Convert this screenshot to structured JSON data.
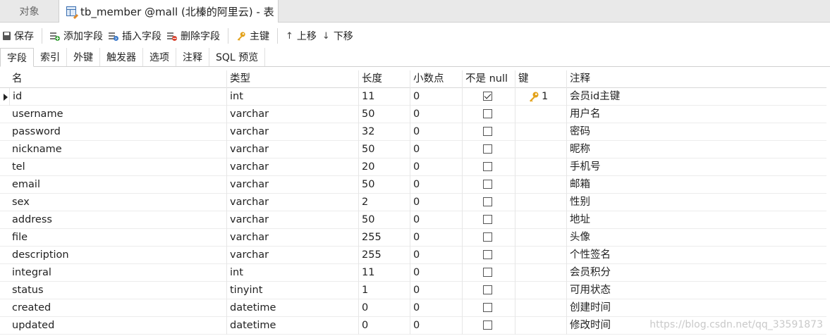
{
  "window_tabs": {
    "objects": "对象",
    "active": "tb_member @mall (北榛的阿里云) - 表"
  },
  "toolbar": {
    "save": "保存",
    "add_field": "添加字段",
    "insert_field": "插入字段",
    "delete_field": "删除字段",
    "primary_key": "主键",
    "move_up": "上移",
    "move_down": "下移"
  },
  "subtabs": [
    "字段",
    "索引",
    "外键",
    "触发器",
    "选项",
    "注释",
    "SQL 预览"
  ],
  "columns": {
    "name": "名",
    "type": "类型",
    "length": "长度",
    "decimals": "小数点",
    "not_null": "不是 null",
    "key": "键",
    "comment": "注释"
  },
  "rows": [
    {
      "name": "id",
      "type": "int",
      "length": "11",
      "decimals": "0",
      "not_null": true,
      "key": "1",
      "comment": "会员id主键"
    },
    {
      "name": "username",
      "type": "varchar",
      "length": "50",
      "decimals": "0",
      "not_null": false,
      "key": "",
      "comment": "用户名"
    },
    {
      "name": "password",
      "type": "varchar",
      "length": "32",
      "decimals": "0",
      "not_null": false,
      "key": "",
      "comment": "密码"
    },
    {
      "name": "nickname",
      "type": "varchar",
      "length": "50",
      "decimals": "0",
      "not_null": false,
      "key": "",
      "comment": "昵称"
    },
    {
      "name": "tel",
      "type": "varchar",
      "length": "20",
      "decimals": "0",
      "not_null": false,
      "key": "",
      "comment": "手机号"
    },
    {
      "name": "email",
      "type": "varchar",
      "length": "50",
      "decimals": "0",
      "not_null": false,
      "key": "",
      "comment": "邮箱"
    },
    {
      "name": "sex",
      "type": "varchar",
      "length": "2",
      "decimals": "0",
      "not_null": false,
      "key": "",
      "comment": "性别"
    },
    {
      "name": "address",
      "type": "varchar",
      "length": "50",
      "decimals": "0",
      "not_null": false,
      "key": "",
      "comment": "地址"
    },
    {
      "name": "file",
      "type": "varchar",
      "length": "255",
      "decimals": "0",
      "not_null": false,
      "key": "",
      "comment": "头像"
    },
    {
      "name": "description",
      "type": "varchar",
      "length": "255",
      "decimals": "0",
      "not_null": false,
      "key": "",
      "comment": "个性签名"
    },
    {
      "name": "integral",
      "type": "int",
      "length": "11",
      "decimals": "0",
      "not_null": false,
      "key": "",
      "comment": "会员积分"
    },
    {
      "name": "status",
      "type": "tinyint",
      "length": "1",
      "decimals": "0",
      "not_null": false,
      "key": "",
      "comment": "可用状态"
    },
    {
      "name": "created",
      "type": "datetime",
      "length": "0",
      "decimals": "0",
      "not_null": false,
      "key": "",
      "comment": "创建时间"
    },
    {
      "name": "updated",
      "type": "datetime",
      "length": "0",
      "decimals": "0",
      "not_null": false,
      "key": "",
      "comment": "修改时间"
    }
  ],
  "watermark": "https://blog.csdn.net/qq_33591873",
  "colors": {
    "key_icon": "#e3a21a",
    "tab_bg": "#e9e9e9"
  }
}
